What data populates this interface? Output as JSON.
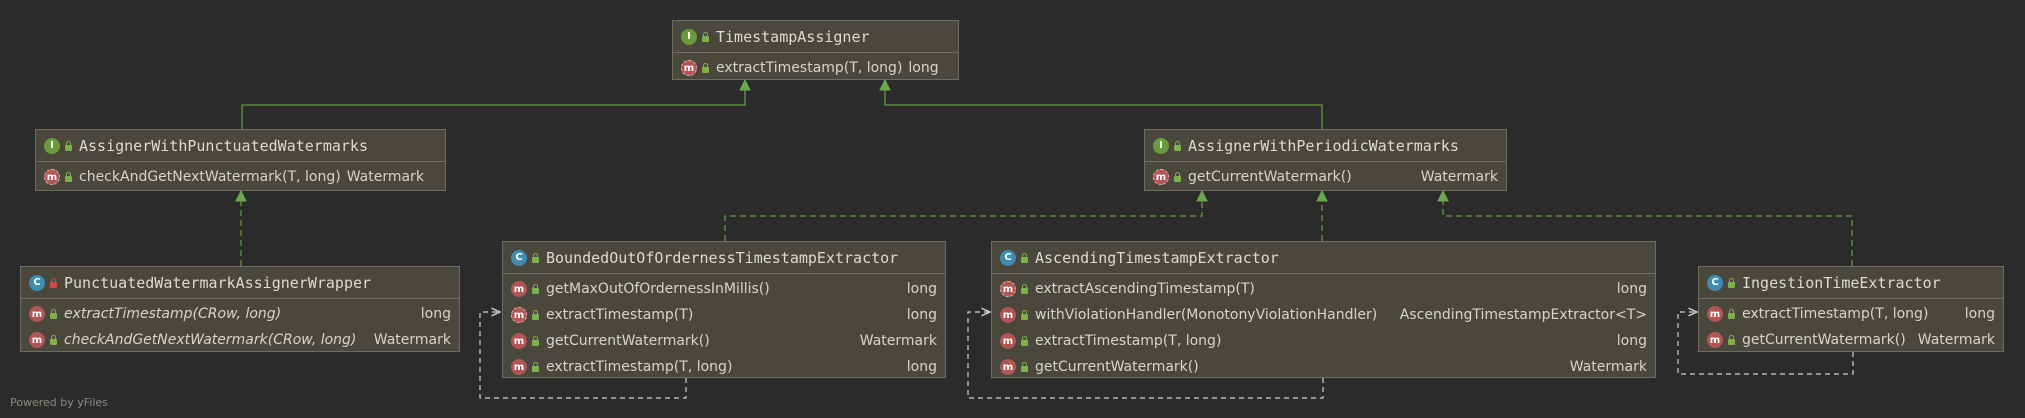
{
  "diagram": {
    "footer": "Powered by yFiles",
    "nodes": {
      "timestamp_assigner": {
        "title": "TimestampAssigner",
        "kind": "interface",
        "methods": [
          {
            "sig": "extractTimestamp(T, long)",
            "ret": "long"
          }
        ]
      },
      "assigner_punctuated": {
        "title": "AssignerWithPunctuatedWatermarks",
        "kind": "interface",
        "methods": [
          {
            "sig": "checkAndGetNextWatermark(T, long)",
            "ret": "Watermark"
          }
        ]
      },
      "assigner_periodic": {
        "title": "AssignerWithPeriodicWatermarks",
        "kind": "interface",
        "methods": [
          {
            "sig": "getCurrentWatermark()",
            "ret": "Watermark"
          }
        ]
      },
      "punctuated_wrapper": {
        "title": "PunctuatedWatermarkAssignerWrapper",
        "kind": "class",
        "methods": [
          {
            "sig": "extractTimestamp(CRow, long)",
            "ret": "long"
          },
          {
            "sig": "checkAndGetNextWatermark(CRow, long)",
            "ret": "Watermark"
          }
        ]
      },
      "bounded_extractor": {
        "title": "BoundedOutOfOrdernessTimestampExtractor",
        "kind": "abstract class",
        "methods": [
          {
            "sig": "getMaxOutOfOrdernessInMillis()",
            "ret": "long"
          },
          {
            "sig": "extractTimestamp(T)",
            "ret": "long"
          },
          {
            "sig": "getCurrentWatermark()",
            "ret": "Watermark"
          },
          {
            "sig": "extractTimestamp(T, long)",
            "ret": "long"
          }
        ]
      },
      "ascending_extractor": {
        "title": "AscendingTimestampExtractor",
        "kind": "abstract class",
        "methods": [
          {
            "sig": "extractAscendingTimestamp(T)",
            "ret": "long"
          },
          {
            "sig": "withViolationHandler(MonotonyViolationHandler)",
            "ret": "AscendingTimestampExtractor<T>"
          },
          {
            "sig": "extractTimestamp(T, long)",
            "ret": "long"
          },
          {
            "sig": "getCurrentWatermark()",
            "ret": "Watermark"
          }
        ]
      },
      "ingestion_extractor": {
        "title": "IngestionTimeExtractor",
        "kind": "class",
        "methods": [
          {
            "sig": "extractTimestamp(T, long)",
            "ret": "long"
          },
          {
            "sig": "getCurrentWatermark()",
            "ret": "Watermark"
          }
        ]
      }
    },
    "colors": {
      "background": "#2b2b2b",
      "node_fill": "#4a473d",
      "extends_edge": "#5f9a3f",
      "implements_edge": "#5f9a3f",
      "self_edge": "#bdbdbd"
    }
  }
}
